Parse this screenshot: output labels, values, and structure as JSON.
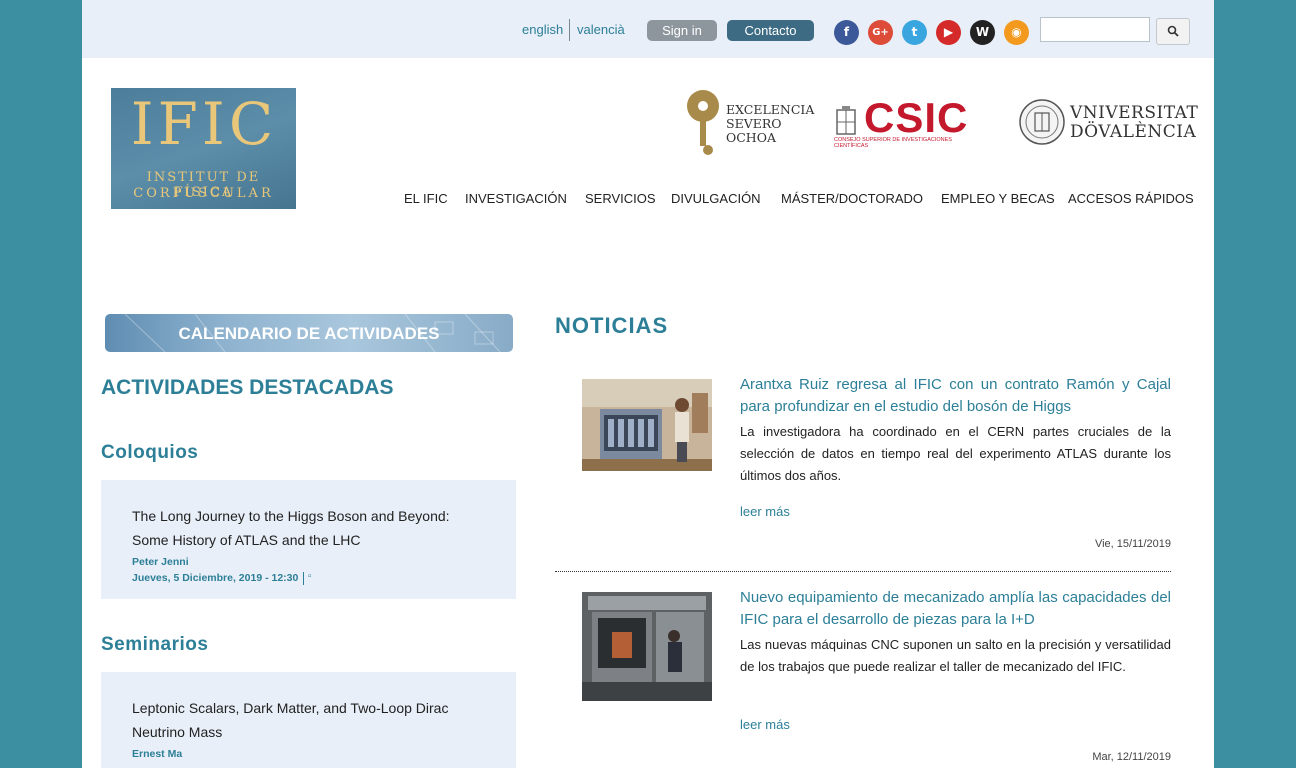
{
  "topbar": {
    "lang_english": "english",
    "lang_valencia": "valencià",
    "signin_label": "Sign in",
    "contacto_label": "Contacto",
    "social": [
      {
        "name": "facebook-icon",
        "glyph": "f"
      },
      {
        "name": "google-plus-icon",
        "glyph": "G+"
      },
      {
        "name": "twitter-icon",
        "glyph": "t"
      },
      {
        "name": "youtube-icon",
        "glyph": "▶"
      },
      {
        "name": "wordpress-icon",
        "glyph": "W"
      },
      {
        "name": "rss-icon",
        "glyph": "◉"
      }
    ],
    "search_value": "",
    "search_button_icon": "search-icon"
  },
  "logos": {
    "ific_letters": "IFIC",
    "ific_line1": "INSTITUT DE FÍSICA",
    "ific_line2": "CORPUSCULAR",
    "severo_line1": "EXCELENCIA",
    "severo_line2": "SEVERO",
    "severo_line3": "OCHOA",
    "csic_word": "CSIC",
    "csic_sub": "CONSEJO SUPERIOR DE INVESTIGACIONES CIENTÍFICAS",
    "uv_line1": "VNIVERSITAT",
    "uv_line2": "DÖVALÈNCIA"
  },
  "nav": {
    "items": [
      "EL IFIC",
      "INVESTIGACIÓN",
      "SERVICIOS",
      "DIVULGACIÓN",
      "MÁSTER/DOCTORADO",
      "EMPLEO Y BECAS",
      "ACCESOS RÁPIDOS"
    ]
  },
  "sidebar": {
    "calendar_banner": "CALENDARIO DE ACTIVIDADES",
    "destacadas": "ACTIVIDADES DESTACADAS",
    "coloquios_heading": "Coloquios",
    "seminarios_heading": "Seminarios",
    "coloquio": {
      "title": "The Long Journey to the Higgs Boson and Beyond: Some History of ATLAS and the LHC",
      "speaker": "Peter Jenni",
      "date": "Jueves, 5 Diciembre, 2019 - 12:30",
      "icon": "calendar-icon"
    },
    "seminario": {
      "title": "Leptonic Scalars, Dark Matter, and Two-Loop Dirac Neutrino Mass",
      "speaker": "Ernest Ma"
    }
  },
  "news": {
    "heading": "NOTICIAS",
    "items": [
      {
        "title": "Arantxa Ruiz regresa al IFIC con un contrato Ramón y Cajal para profundizar en el estudio del bosón de Higgs",
        "body": "La investigadora ha coordinado en el CERN partes cruciales de la selección de datos en tiempo real del experimento ATLAS durante los últimos dos años.",
        "more": "leer más",
        "date": "Vie, 15/11/2019"
      },
      {
        "title": "Nuevo equipamiento de mecanizado amplía las capacidades del IFIC para el desarrollo de piezas para la I+D",
        "body": "Las nuevas máquinas CNC suponen un salto en la precisión y versatilidad de los trabajos que puede realizar el taller de mecanizado del IFIC.",
        "more": "leer más",
        "date": "Mar, 12/11/2019"
      }
    ]
  }
}
